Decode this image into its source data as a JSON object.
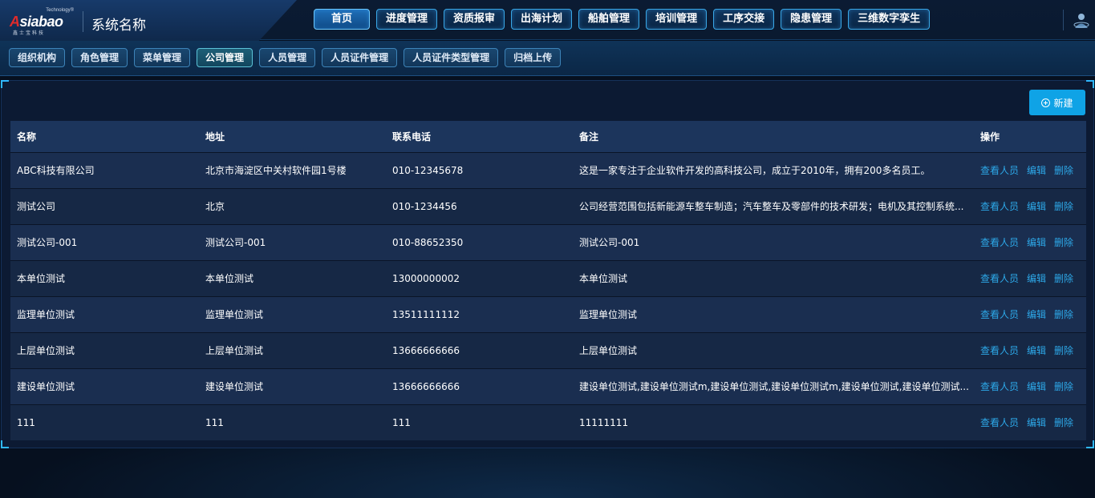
{
  "app": {
    "logo_text": "Asiabao",
    "logo_tech": "Technology®",
    "logo_sub": "鑫士宝科技",
    "title": "系统名称"
  },
  "topnav": [
    {
      "label": "首页",
      "active": true
    },
    {
      "label": "进度管理"
    },
    {
      "label": "资质报审"
    },
    {
      "label": "出海计划"
    },
    {
      "label": "船舶管理"
    },
    {
      "label": "培训管理"
    },
    {
      "label": "工序交接"
    },
    {
      "label": "隐患管理"
    },
    {
      "label": "三维数字孪生"
    }
  ],
  "subnav": [
    {
      "label": "组织机构"
    },
    {
      "label": "角色管理"
    },
    {
      "label": "菜单管理"
    },
    {
      "label": "公司管理",
      "active": true
    },
    {
      "label": "人员管理"
    },
    {
      "label": "人员证件管理"
    },
    {
      "label": "人员证件类型管理"
    },
    {
      "label": "归档上传"
    }
  ],
  "toolbar": {
    "new_label": "新建"
  },
  "table": {
    "headers": {
      "name": "名称",
      "address": "地址",
      "phone": "联系电话",
      "remark": "备注",
      "ops": "操作"
    },
    "actions": {
      "view": "查看人员",
      "edit": "编辑",
      "delete": "删除"
    },
    "rows": [
      {
        "name": "ABC科技有限公司",
        "address": "北京市海淀区中关村软件园1号楼",
        "phone": "010-12345678",
        "remark": "这是一家专注于企业软件开发的高科技公司，成立于2010年，拥有200多名员工。"
      },
      {
        "name": "测试公司",
        "address": "北京",
        "phone": "010-1234456",
        "remark": "公司经营范围包括新能源车整车制造；汽车整车及零部件的技术研发；电机及其控制系统..."
      },
      {
        "name": "测试公司-001",
        "address": "测试公司-001",
        "phone": "010-88652350",
        "remark": "测试公司-001"
      },
      {
        "name": "本单位测试",
        "address": "本单位测试",
        "phone": "13000000002",
        "remark": "本单位测试"
      },
      {
        "name": "监理单位测试",
        "address": "监理单位测试",
        "phone": "13511111112",
        "remark": "监理单位测试"
      },
      {
        "name": "上层单位测试",
        "address": "上层单位测试",
        "phone": "13666666666",
        "remark": "上层单位测试"
      },
      {
        "name": "建设单位测试",
        "address": "建设单位测试",
        "phone": "13666666666",
        "remark": "建设单位测试,建设单位测试m,建设单位测试,建设单位测试m,建设单位测试,建设单位测试..."
      },
      {
        "name": "111",
        "address": "111",
        "phone": "111",
        "remark": "11111111"
      }
    ]
  },
  "colors": {
    "accent": "#0fa3e6",
    "link": "#2da8e8",
    "header_bg": "#1c355c"
  }
}
